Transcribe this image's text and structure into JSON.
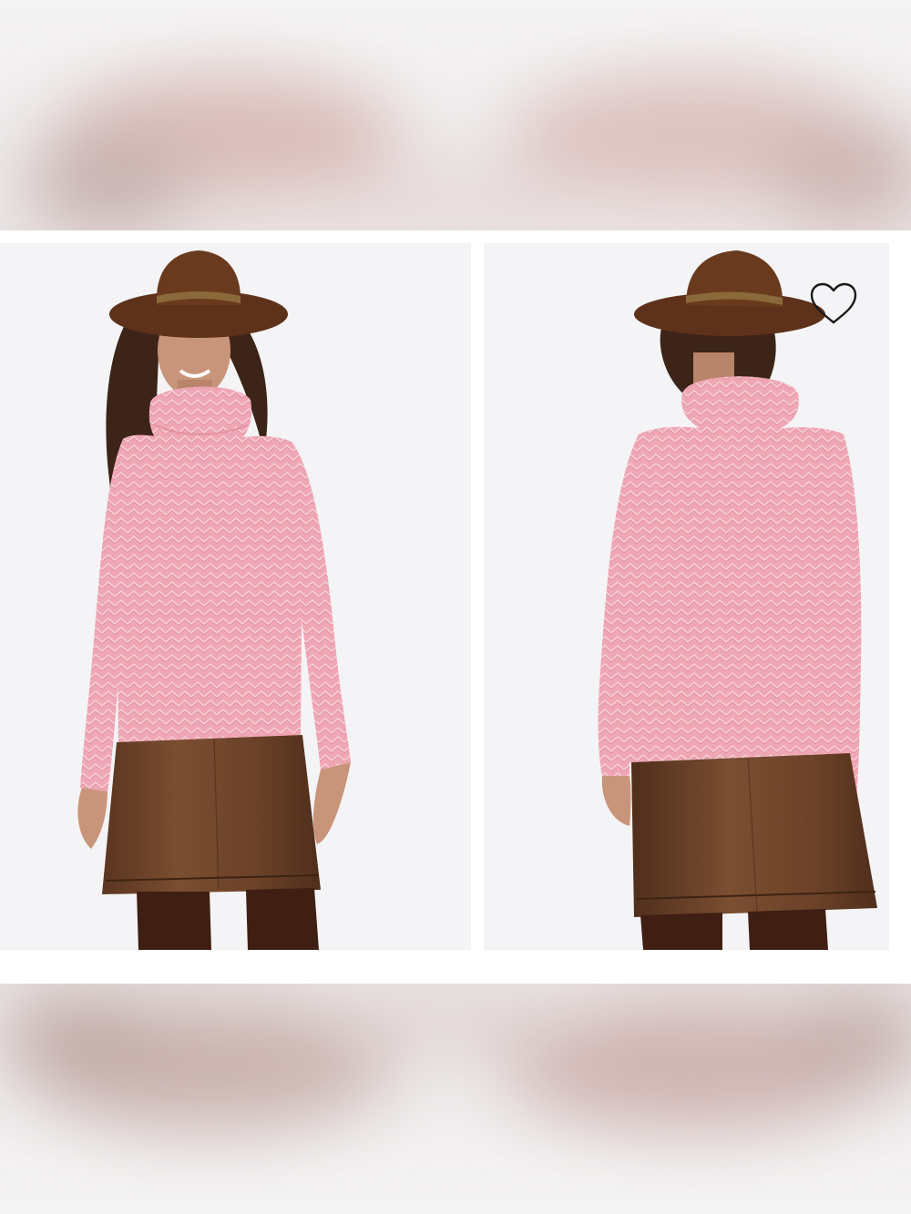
{
  "gallery": {
    "images": [
      {
        "view": "front",
        "alt": ""
      },
      {
        "view": "back",
        "alt": ""
      }
    ],
    "wishlist": {
      "icon": "heart-outline-icon",
      "active": false
    }
  },
  "colors": {
    "sweater": "#efa7b5",
    "sweater_dark": "#e3929f",
    "hat": "#6a3a1e",
    "skirt": "#6e4529",
    "tights": "#3f1f14",
    "hair": "#3c2418",
    "skin": "#c9957a",
    "photo_bg": "#f4f4f6"
  }
}
